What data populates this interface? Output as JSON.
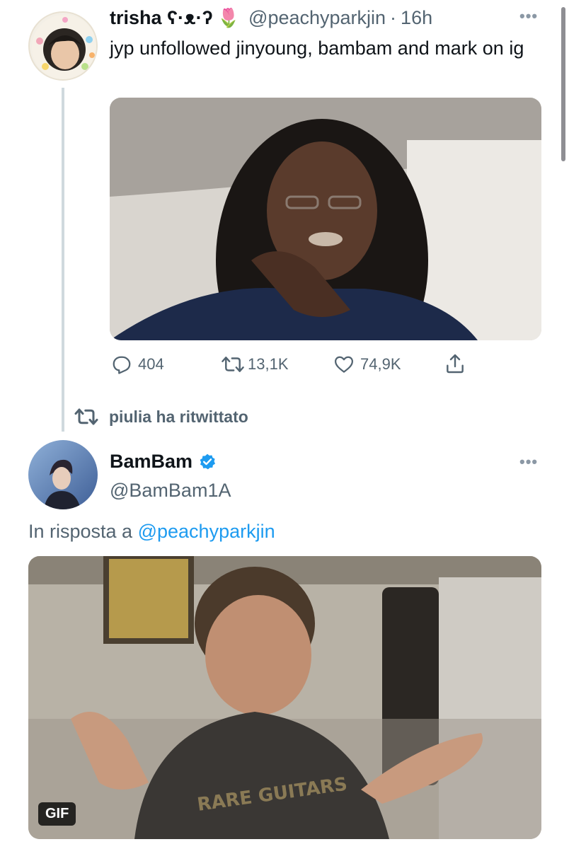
{
  "tweet1": {
    "name": "trisha ʕ·ᴥ·ʔ",
    "emoji": "🌷",
    "handle": "@peachyparkjin",
    "separator": "·",
    "time": "16h",
    "text": "jyp unfollowed jinyoung, bambam and mark on ig",
    "actions": {
      "replies": "404",
      "retweets": "13,1K",
      "likes": "74,9K"
    },
    "icons": [
      "reply-icon",
      "retweet-icon",
      "like-icon",
      "share-icon",
      "more-icon"
    ]
  },
  "retweet_context": {
    "label": "piulia ha ritwittato"
  },
  "tweet2": {
    "name": "BamBam",
    "verified": true,
    "handle": "@BamBam1A",
    "reply_prefix": "In risposta a",
    "reply_to": "@peachyparkjin",
    "media_badge": "GIF",
    "icons": [
      "verified-badge-icon",
      "more-icon"
    ]
  },
  "colors": {
    "accent": "#1d9bf0",
    "secondary_text": "#536471",
    "thread_line": "#cfd9de"
  }
}
